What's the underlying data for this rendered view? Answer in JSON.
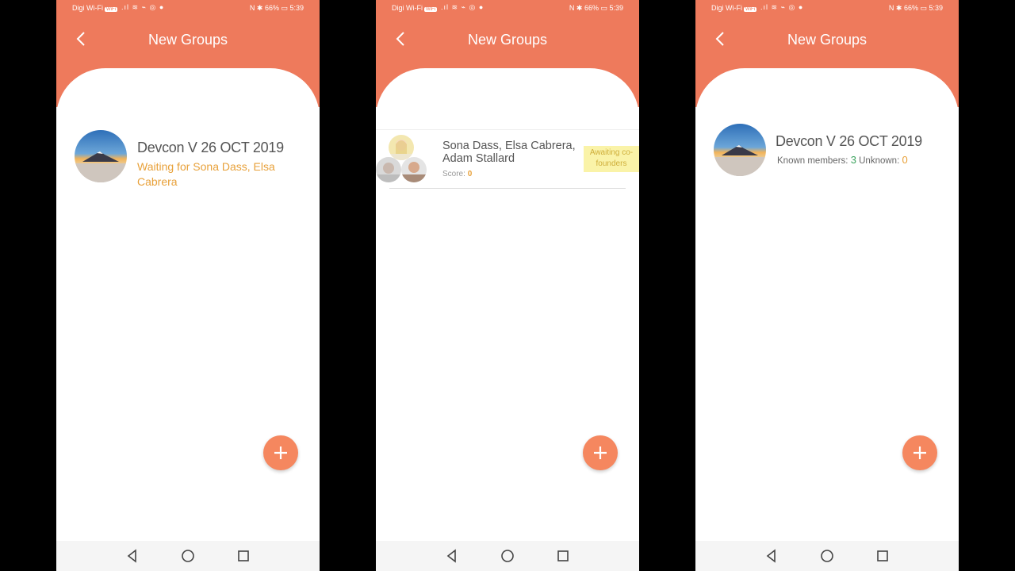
{
  "status_bar": {
    "carrier": "Digi Wi-Fi",
    "wifi_tag": "WiFi",
    "left_icons": ".ıl ≋ ⌁ ◎ ●",
    "right_text": "N ✱ 66% ▭ 5:39"
  },
  "screens": [
    {
      "title": "New Groups",
      "group": {
        "name": "Devcon V 26 OCT 2019",
        "waiting_text": "Waiting for Sona Dass, Elsa Cabrera"
      }
    },
    {
      "title": "New Groups",
      "group": {
        "members": "Sona Dass, Elsa Cabrera, Adam Stallard",
        "score_label": "Score:",
        "score_value": "0",
        "badge": "Awaiting co-founders"
      }
    },
    {
      "title": "New Groups",
      "group": {
        "name": "Devcon V 26 OCT 2019",
        "known_label": "Known members:",
        "known_value": "3",
        "unknown_label": "Unknown:",
        "unknown_value": "0"
      }
    }
  ],
  "colors": {
    "header": "#EE7A5C",
    "fab": "#F5875F",
    "accent_orange": "#E8A13A",
    "known_green": "#3CA35E",
    "badge_bg": "#FAF3A8"
  },
  "icons": [
    "back-arrow-icon",
    "add-icon",
    "nav-back-icon",
    "nav-home-icon",
    "nav-recents-icon"
  ]
}
